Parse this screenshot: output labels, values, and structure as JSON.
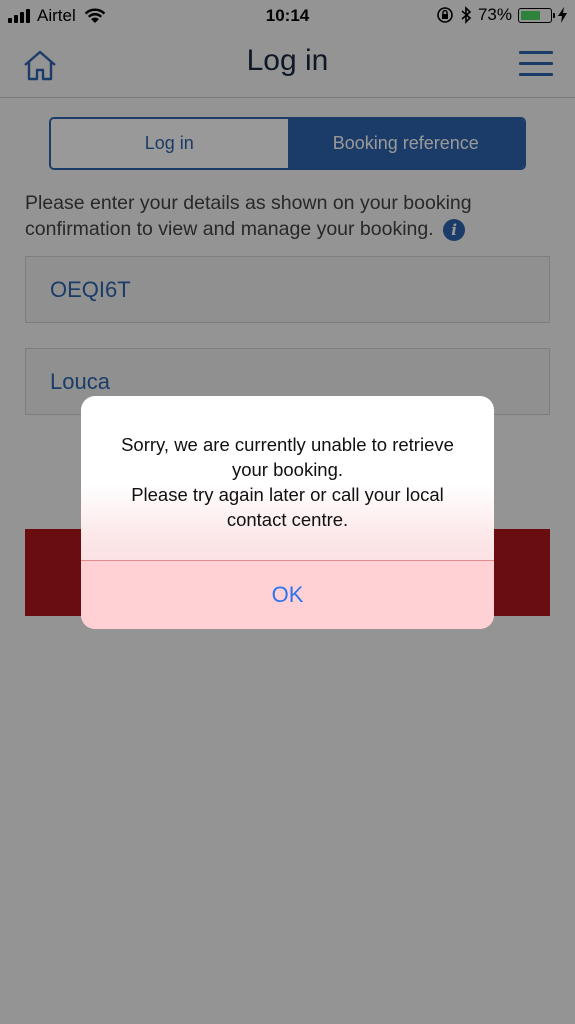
{
  "status_bar": {
    "carrier": "Airtel",
    "time": "10:14",
    "battery_percent": "73%",
    "battery_level": 0.73
  },
  "nav": {
    "title": "Log in",
    "home_icon": "home-icon",
    "menu_icon": "hamburger-menu-icon"
  },
  "tabs": [
    {
      "label": "Log in",
      "selected": false
    },
    {
      "label": "Booking reference",
      "selected": true
    }
  ],
  "instructions": {
    "text": "Please enter your details as shown on your booking confirmation to view and manage your booking.",
    "info_glyph": "i"
  },
  "form": {
    "booking_reference": "OEQI6T",
    "last_name": "Louca"
  },
  "alert": {
    "message_line1": "Sorry, we are currently unable to retrieve your booking.",
    "message_line2": "Please try again later or call your local contact centre.",
    "ok_label": "OK"
  },
  "colors": {
    "brand_blue": "#2e64ad",
    "submit_red": "#b0171c",
    "battery_green": "#4cd964"
  }
}
